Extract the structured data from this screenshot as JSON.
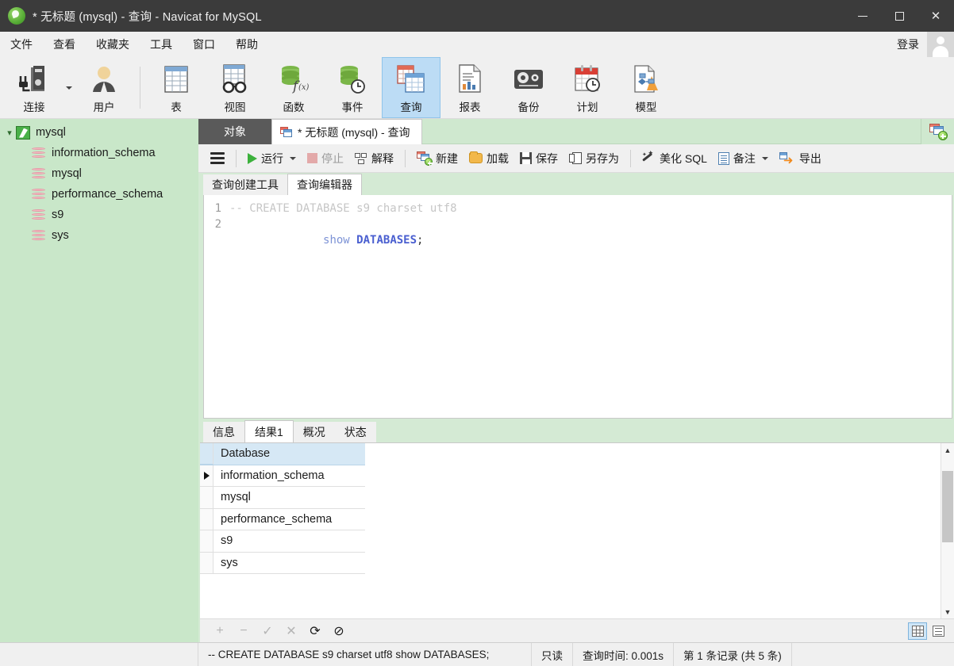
{
  "window": {
    "title": "* 无标题 (mysql) - 查询 - Navicat for MySQL",
    "logo_icon": "navicat-leaf-icon",
    "minimize_icon": "minimize-icon",
    "maximize_icon": "maximize-icon",
    "close_icon": "close-icon"
  },
  "menubar": {
    "items": [
      {
        "label": "文件"
      },
      {
        "label": "查看"
      },
      {
        "label": "收藏夹"
      },
      {
        "label": "工具"
      },
      {
        "label": "窗口"
      },
      {
        "label": "帮助"
      }
    ],
    "login_label": "登录",
    "avatar_icon": "user-avatar-icon"
  },
  "ribbon": {
    "items": [
      {
        "label": "连接",
        "icon": "server-plug-icon",
        "selected": false,
        "has_dropdown": true
      },
      {
        "label": "用户",
        "icon": "user-icon",
        "selected": false
      },
      {
        "label": "表",
        "icon": "table-icon",
        "selected": false
      },
      {
        "label": "视图",
        "icon": "view-glasses-icon",
        "selected": false
      },
      {
        "label": "函数",
        "icon": "function-fx-icon",
        "selected": false
      },
      {
        "label": "事件",
        "icon": "event-clock-icon",
        "selected": false
      },
      {
        "label": "查询",
        "icon": "query-icon",
        "selected": true
      },
      {
        "label": "报表",
        "icon": "report-chart-icon",
        "selected": false
      },
      {
        "label": "备份",
        "icon": "backup-tape-icon",
        "selected": false
      },
      {
        "label": "计划",
        "icon": "schedule-calendar-icon",
        "selected": false
      },
      {
        "label": "模型",
        "icon": "model-diagram-icon",
        "selected": false
      }
    ]
  },
  "sidebar": {
    "root": {
      "label": "mysql",
      "icon": "connection-icon",
      "expander": "chevron-down-icon"
    },
    "databases": [
      {
        "label": "information_schema",
        "icon": "database-icon"
      },
      {
        "label": "mysql",
        "icon": "database-icon"
      },
      {
        "label": "performance_schema",
        "icon": "database-icon"
      },
      {
        "label": "s9",
        "icon": "database-icon"
      },
      {
        "label": "sys",
        "icon": "database-icon"
      }
    ]
  },
  "tabs": {
    "object_tab": "对象",
    "query_tab": "* 无标题 (mysql) - 查询",
    "query_tab_icon": "query-tab-icon",
    "new_tab_icon": "new-tab-plus-icon"
  },
  "query_toolbar": {
    "menu_icon": "hamburger-menu-icon",
    "buttons": [
      {
        "label": "运行",
        "icon": "play-icon",
        "disabled": false,
        "has_dropdown": true
      },
      {
        "label": "停止",
        "icon": "stop-icon",
        "disabled": true
      },
      {
        "label": "解释",
        "icon": "explain-icon",
        "disabled": false
      },
      {
        "label": "新建",
        "icon": "new-query-icon",
        "disabled": false
      },
      {
        "label": "加载",
        "icon": "folder-open-icon",
        "disabled": false
      },
      {
        "label": "保存",
        "icon": "save-floppy-icon",
        "disabled": false
      },
      {
        "label": "另存为",
        "icon": "save-as-icon",
        "disabled": false
      },
      {
        "label": "美化 SQL",
        "icon": "magic-wand-icon",
        "disabled": false
      },
      {
        "label": "备注",
        "icon": "note-icon",
        "disabled": false,
        "has_dropdown": true
      },
      {
        "label": "导出",
        "icon": "export-arrow-icon",
        "disabled": false
      }
    ]
  },
  "editor": {
    "subtabs": [
      {
        "label": "查询创建工具",
        "active": false
      },
      {
        "label": "查询编辑器",
        "active": true
      }
    ],
    "lines": [
      {
        "number": "1",
        "comment": "-- CREATE DATABASE s9 charset utf8"
      },
      {
        "number": "2",
        "kw": "show",
        "kw2": "DATABASES",
        "punct": ";"
      }
    ]
  },
  "results": {
    "tabs": [
      {
        "label": "信息",
        "active": false
      },
      {
        "label": "结果1",
        "active": true
      },
      {
        "label": "概况",
        "active": false
      },
      {
        "label": "状态",
        "active": false
      }
    ],
    "grid": {
      "columns": [
        "Database"
      ],
      "rows": [
        {
          "value": "information_schema",
          "current": true
        },
        {
          "value": "mysql",
          "current": false
        },
        {
          "value": "performance_schema",
          "current": false
        },
        {
          "value": "s9",
          "current": false
        },
        {
          "value": "sys",
          "current": false
        }
      ]
    },
    "scrollbar": {
      "up_icon": "scroll-up-icon",
      "down_icon": "scroll-down-icon"
    }
  },
  "navbar": {
    "buttons": [
      {
        "icon": "add-record-icon",
        "glyph": "+",
        "enabled": false
      },
      {
        "icon": "remove-record-icon",
        "glyph": "−",
        "enabled": false
      },
      {
        "icon": "confirm-icon",
        "glyph": "✓",
        "enabled": false
      },
      {
        "icon": "cancel-icon",
        "glyph": "✕",
        "enabled": false
      },
      {
        "icon": "refresh-icon",
        "glyph": "⟳",
        "enabled": true
      },
      {
        "icon": "stop-loading-icon",
        "glyph": "⊘",
        "enabled": true
      }
    ],
    "view_modes": [
      {
        "icon": "grid-view-icon",
        "active": true
      },
      {
        "icon": "form-view-icon",
        "active": false
      }
    ]
  },
  "statusbar": {
    "sql": "-- CREATE DATABASE s9 charset utf8 show DATABASES;",
    "readonly": "只读",
    "query_time": "查询时间: 0.001s",
    "record_info": "第 1 条记录 (共 5 条)"
  },
  "colors": {
    "titlebar": "#3b3b3b",
    "sidebar": "#c9e7c9",
    "pane": "#d4ead4",
    "accent_selected": "#bcdcf5",
    "grid_header": "#d6e8f5"
  }
}
